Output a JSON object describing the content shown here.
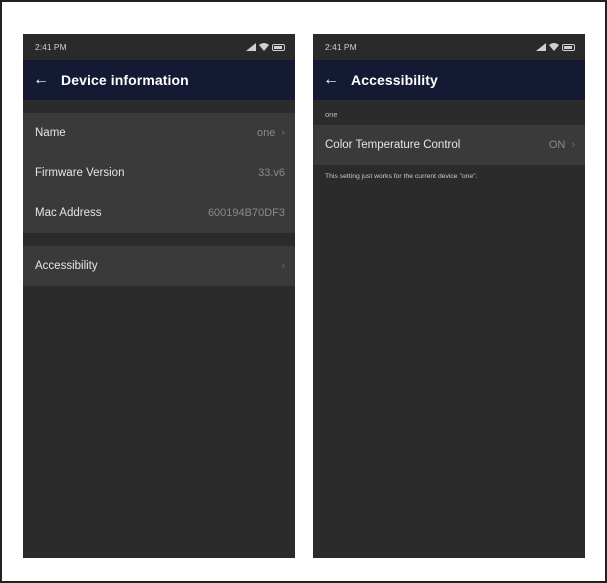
{
  "left": {
    "status": {
      "time": "2:41 PM"
    },
    "appbar": {
      "title": "Device information"
    },
    "info_rows": [
      {
        "label": "Name",
        "value": "one"
      },
      {
        "label": "Firmware Version",
        "value": "33.v6"
      },
      {
        "label": "Mac Address",
        "value": "600194B70DF3"
      }
    ],
    "accessibility_row": {
      "label": "Accessibility"
    }
  },
  "right": {
    "status": {
      "time": "2:41 PM"
    },
    "appbar": {
      "title": "Accessibility"
    },
    "section_label": "one",
    "setting": {
      "label": "Color Temperature Control",
      "value": "ON"
    },
    "note": "This setting just works for the current device \"one\"."
  }
}
